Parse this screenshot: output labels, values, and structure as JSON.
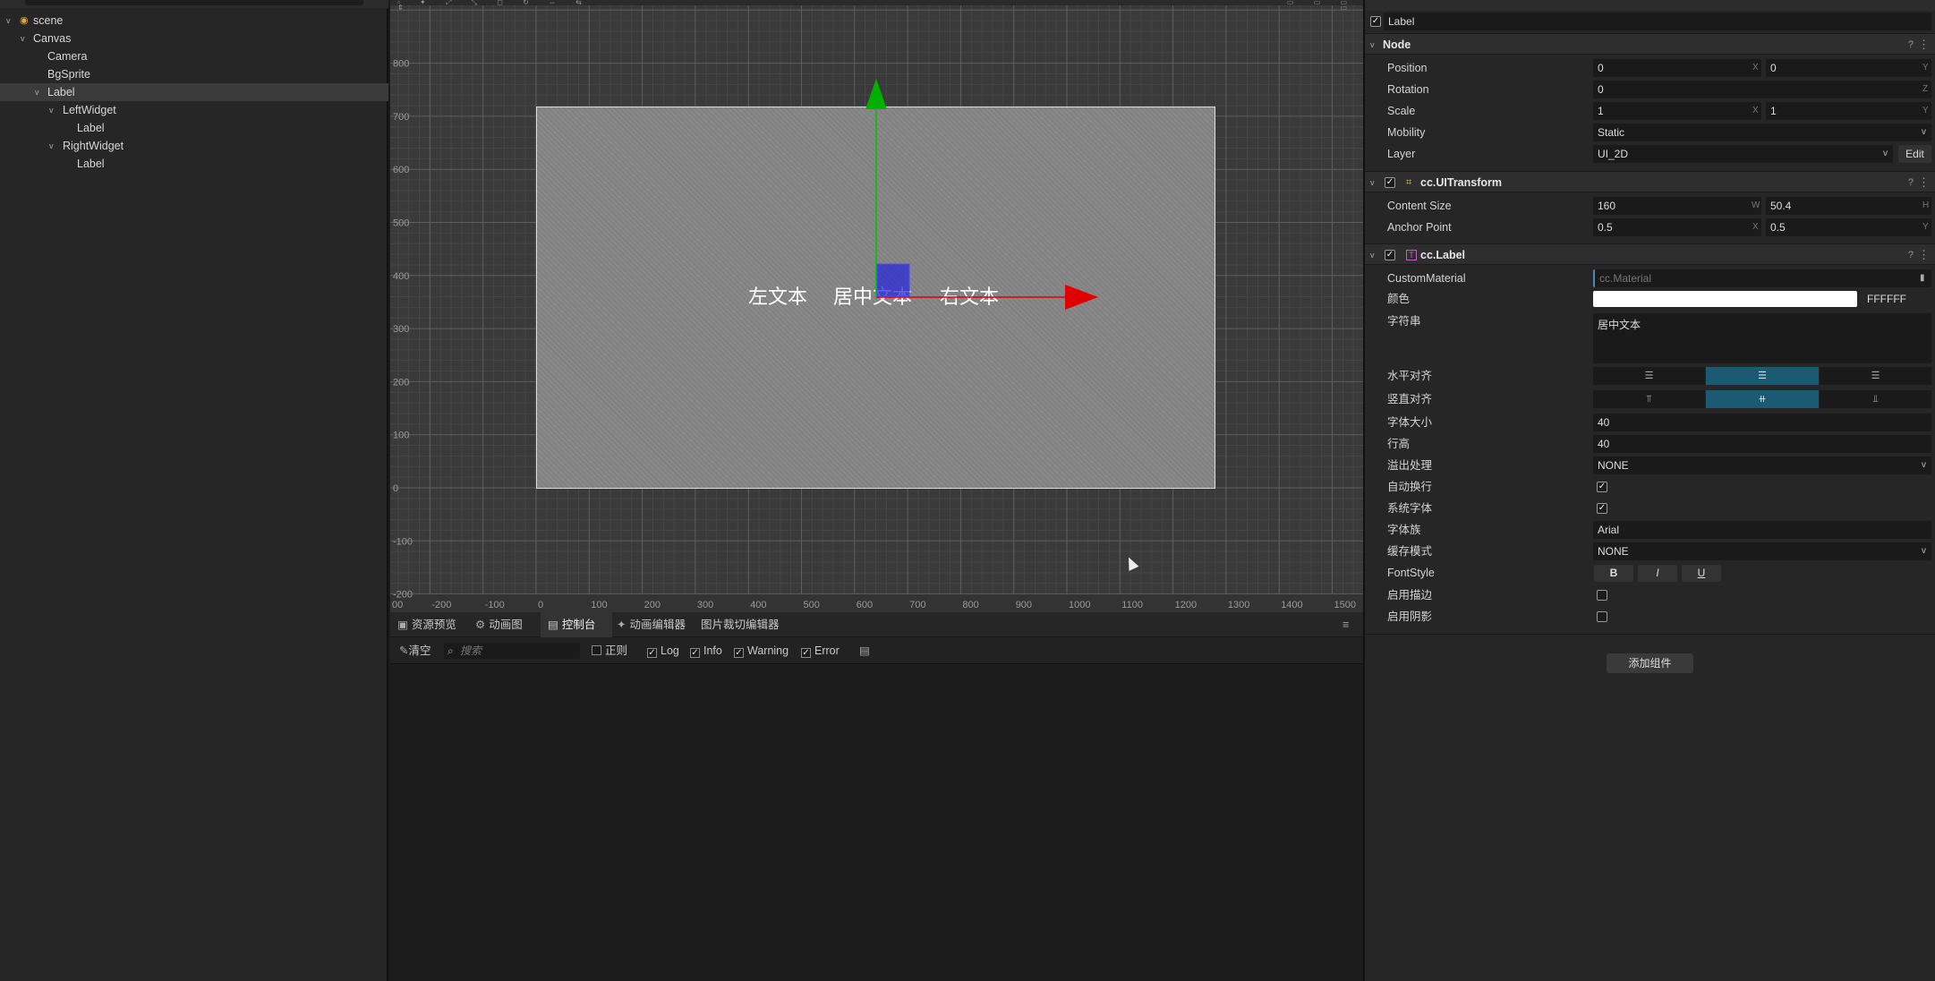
{
  "hierarchy": {
    "nodes": [
      {
        "label": "scene",
        "depth": 0,
        "expanded": true,
        "icon": "scene-icon"
      },
      {
        "label": "Canvas",
        "depth": 1,
        "expanded": true
      },
      {
        "label": "Camera",
        "depth": 2
      },
      {
        "label": "BgSprite",
        "depth": 2
      },
      {
        "label": "Label",
        "depth": 2,
        "expanded": true,
        "selected": true
      },
      {
        "label": "LeftWidget",
        "depth": 3,
        "expanded": true
      },
      {
        "label": "Label",
        "depth": 4
      },
      {
        "label": "RightWidget",
        "depth": 3,
        "expanded": true
      },
      {
        "label": "Label",
        "depth": 4
      }
    ]
  },
  "scene": {
    "y_ticks": [
      "800",
      "700",
      "600",
      "500",
      "400",
      "300",
      "200",
      "100",
      "0",
      "-100",
      "-200"
    ],
    "x_ticks": [
      "00",
      "-200",
      "-100",
      "0",
      "100",
      "200",
      "300",
      "400",
      "500",
      "600",
      "700",
      "800",
      "900",
      "1000",
      "1100",
      "1200",
      "1300",
      "1400",
      "1500"
    ],
    "labels": {
      "left": "左文本",
      "center": "居中文本",
      "right": "右文本"
    }
  },
  "console": {
    "tabs": [
      "资源预览",
      "动画图",
      "控制台",
      "动画编辑器",
      "图片裁切编辑器"
    ],
    "active_tab": "控制台",
    "clear": "清空",
    "search_placeholder": "搜索",
    "regex": "正则",
    "log": "Log",
    "info": "Info",
    "warning": "Warning",
    "error": "Error"
  },
  "inspector": {
    "name": "Label",
    "node": {
      "title": "Node",
      "position_label": "Position",
      "position": {
        "x": "0",
        "y": "0"
      },
      "rotation_label": "Rotation",
      "rotation": "0",
      "scale_label": "Scale",
      "scale": {
        "x": "1",
        "y": "1"
      },
      "mobility_label": "Mobility",
      "mobility": "Static",
      "layer_label": "Layer",
      "layer": "UI_2D",
      "edit": "Edit"
    },
    "uitransform": {
      "title": "cc.UITransform",
      "content_size_label": "Content Size",
      "content_size": {
        "w": "160",
        "h": "50.4"
      },
      "anchor_label": "Anchor Point",
      "anchor": {
        "x": "0.5",
        "y": "0.5"
      }
    },
    "label": {
      "title": "cc.Label",
      "material_label": "CustomMaterial",
      "material": "cc.Material",
      "color_label": "颜色",
      "color_hex": "FFFFFF",
      "string_label": "字符串",
      "string": "居中文本",
      "halign_label": "水平对齐",
      "valign_label": "竖直对齐",
      "font_size_label": "字体大小",
      "font_size": "40",
      "line_height_label": "行高",
      "line_height": "40",
      "overflow_label": "溢出处理",
      "overflow": "NONE",
      "wrap_label": "自动换行",
      "sysfont_label": "系统字体",
      "family_label": "字体族",
      "family": "Arial",
      "cache_label": "缓存模式",
      "cache": "NONE",
      "fontstyle_label": "FontStyle",
      "bold": "B",
      "italic": "I",
      "underline": "U",
      "outline_label": "启用描边",
      "shadow_label": "启用阴影"
    },
    "add_component": "添加组件"
  },
  "axis_letters": {
    "x": "X",
    "y": "Y",
    "z": "Z",
    "w": "W",
    "h": "H"
  },
  "colors": {
    "accent": "#1a5a73",
    "arrow_x": "#d40000",
    "arrow_y": "#00aa00"
  }
}
